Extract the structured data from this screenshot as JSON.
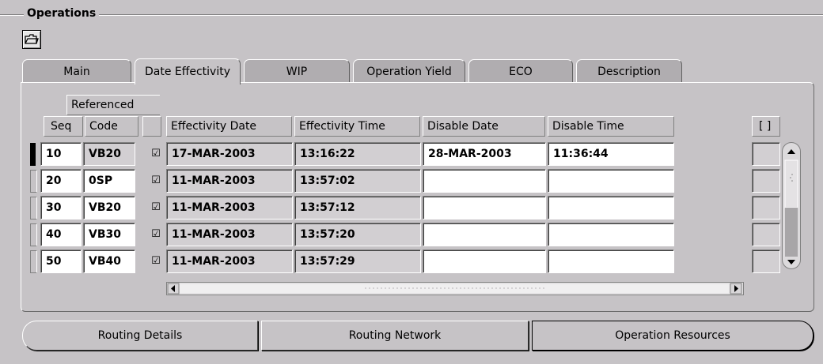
{
  "section": {
    "title": "Operations"
  },
  "toolbar": {
    "icon": "folder-open-icon"
  },
  "tabs": [
    {
      "label": "Main",
      "active": false
    },
    {
      "label": "Date Effectivity",
      "active": true
    },
    {
      "label": "WIP",
      "active": false
    },
    {
      "label": "Operation Yield",
      "active": false
    },
    {
      "label": "ECO",
      "active": false
    },
    {
      "label": "Description",
      "active": false
    }
  ],
  "table": {
    "group_header": "Referenced",
    "headers": {
      "seq": "Seq",
      "code": "Code",
      "effectivity_date": "Effectivity Date",
      "effectivity_time": "Effectivity Time",
      "disable_date": "Disable Date",
      "disable_time": "Disable Time",
      "extra": "[ ]"
    },
    "rows": [
      {
        "seq": "10",
        "code": "VB20",
        "referenced": "☑",
        "effectivity_date": "17-MAR-2003",
        "effectivity_time": "13:16:22",
        "disable_date": "28-MAR-2003",
        "disable_time": "11:36:44"
      },
      {
        "seq": "20",
        "code": "0SP",
        "referenced": "☑",
        "effectivity_date": "11-MAR-2003",
        "effectivity_time": "13:57:02",
        "disable_date": "",
        "disable_time": ""
      },
      {
        "seq": "30",
        "code": "VB20",
        "referenced": "☑",
        "effectivity_date": "11-MAR-2003",
        "effectivity_time": "13:57:12",
        "disable_date": "",
        "disable_time": ""
      },
      {
        "seq": "40",
        "code": "VB30",
        "referenced": "☑",
        "effectivity_date": "11-MAR-2003",
        "effectivity_time": "13:57:20",
        "disable_date": "",
        "disable_time": ""
      },
      {
        "seq": "50",
        "code": "VB40",
        "referenced": "☑",
        "effectivity_date": "11-MAR-2003",
        "effectivity_time": "13:57:29",
        "disable_date": "",
        "disable_time": ""
      }
    ]
  },
  "buttons": {
    "routing_details": "Routing Details",
    "routing_network": "Routing Network",
    "operation_resources": "Operation Resources"
  }
}
